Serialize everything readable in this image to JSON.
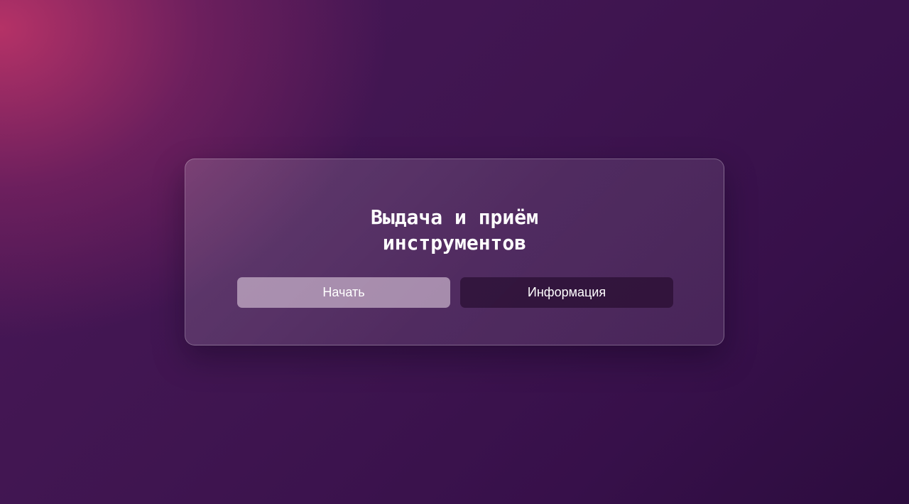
{
  "card": {
    "title": "Выдача и приём\nинструментов"
  },
  "actions": {
    "start_label": "Начать",
    "info_label": "Информация"
  },
  "colors": {
    "background_glow": "#be3468",
    "background_base": "#3f1550",
    "start_button": "#a890b0",
    "info_button": "#3a1f40"
  }
}
